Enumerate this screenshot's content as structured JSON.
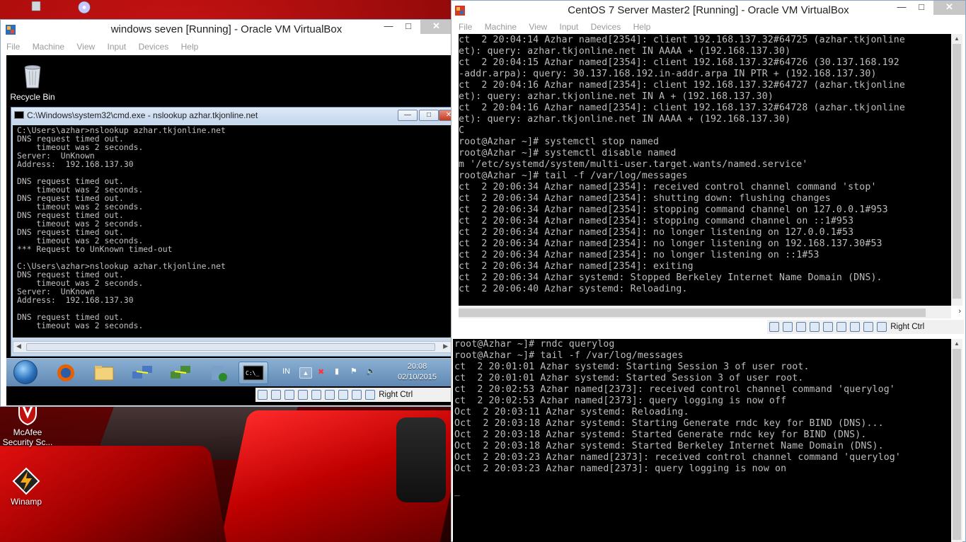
{
  "desktop": {
    "icons": [
      {
        "label": "Recycle Bin"
      },
      {
        "label": "McAfee Security Sc..."
      },
      {
        "label": "Winamp"
      }
    ]
  },
  "win7_vm": {
    "title": "windows seven [Running] - Oracle VM VirtualBox",
    "menu": [
      "File",
      "Machine",
      "View",
      "Input",
      "Devices",
      "Help"
    ],
    "guest_desktop_icon": "Recycle Bin",
    "cmd": {
      "title": "C:\\Windows\\system32\\cmd.exe - nslookup  azhar.tkjonline.net",
      "lines": [
        "C:\\Users\\azhar>nslookup azhar.tkjonline.net",
        "DNS request timed out.",
        "    timeout was 2 seconds.",
        "Server:  UnKnown",
        "Address:  192.168.137.30",
        "",
        "DNS request timed out.",
        "    timeout was 2 seconds.",
        "DNS request timed out.",
        "    timeout was 2 seconds.",
        "DNS request timed out.",
        "    timeout was 2 seconds.",
        "DNS request timed out.",
        "    timeout was 2 seconds.",
        "*** Request to UnKnown timed-out",
        "",
        "C:\\Users\\azhar>nslookup azhar.tkjonline.net",
        "DNS request timed out.",
        "    timeout was 2 seconds.",
        "Server:  UnKnown",
        "Address:  192.168.137.30",
        "",
        "DNS request timed out.",
        "    timeout was 2 seconds."
      ]
    },
    "taskbar": {
      "lang": "IN",
      "time": "20:08",
      "date": "02/10/2015"
    },
    "status_hostkey": "Right Ctrl"
  },
  "centos_vm": {
    "title": "CentOS 7 Server Master2 [Running] - Oracle VM VirtualBox",
    "menu": [
      "File",
      "Machine",
      "View",
      "Input",
      "Devices",
      "Help"
    ],
    "terminal_top": [
      "ct  2 20:04:14 Azhar named[2354]: client 192.168.137.32#64725 (azhar.tkjonline",
      "et): query: azhar.tkjonline.net IN AAAA + (192.168.137.30)",
      "ct  2 20:04:15 Azhar named[2354]: client 192.168.137.32#64726 (30.137.168.192",
      "-addr.arpa): query: 30.137.168.192.in-addr.arpa IN PTR + (192.168.137.30)",
      "ct  2 20:04:16 Azhar named[2354]: client 192.168.137.32#64727 (azhar.tkjonline",
      "et): query: azhar.tkjonline.net IN A + (192.168.137.30)",
      "ct  2 20:04:16 Azhar named[2354]: client 192.168.137.32#64728 (azhar.tkjonline",
      "et): query: azhar.tkjonline.net IN AAAA + (192.168.137.30)",
      "C",
      "root@Azhar ~]# systemctl stop named",
      "root@Azhar ~]# systemctl disable named",
      "m '/etc/systemd/system/multi-user.target.wants/named.service'",
      "root@Azhar ~]# tail -f /var/log/messages",
      "ct  2 20:06:34 Azhar named[2354]: received control channel command 'stop'",
      "ct  2 20:06:34 Azhar named[2354]: shutting down: flushing changes",
      "ct  2 20:06:34 Azhar named[2354]: stopping command channel on 127.0.0.1#953",
      "ct  2 20:06:34 Azhar named[2354]: stopping command channel on ::1#953",
      "ct  2 20:06:34 Azhar named[2354]: no longer listening on 127.0.0.1#53",
      "ct  2 20:06:34 Azhar named[2354]: no longer listening on 192.168.137.30#53",
      "ct  2 20:06:34 Azhar named[2354]: no longer listening on ::1#53",
      "ct  2 20:06:34 Azhar named[2354]: exiting",
      "ct  2 20:06:34 Azhar systemd: Stopped Berkeley Internet Name Domain (DNS).",
      "ct  2 20:06:40 Azhar systemd: Reloading."
    ],
    "status_hostkey": "Right Ctrl",
    "terminal_bottom": [
      "root@Azhar ~]# rndc querylog",
      "root@Azhar ~]# tail -f /var/log/messages",
      "ct  2 20:01:01 Azhar systemd: Starting Session 3 of user root.",
      "ct  2 20:01:01 Azhar systemd: Started Session 3 of user root.",
      "ct  2 20:02:53 Azhar named[2373]: received control channel command 'querylog'",
      "ct  2 20:02:53 Azhar named[2373]: query logging is now off",
      "Oct  2 20:03:11 Azhar systemd: Reloading.",
      "Oct  2 20:03:18 Azhar systemd: Starting Generate rndc key for BIND (DNS)...",
      "Oct  2 20:03:18 Azhar systemd: Started Generate rndc key for BIND (DNS).",
      "Oct  2 20:03:18 Azhar systemd: Started Berkeley Internet Name Domain (DNS).",
      "Oct  2 20:03:23 Azhar named[2373]: received control channel command 'querylog'",
      "Oct  2 20:03:23 Azhar named[2373]: query logging is now on",
      "",
      "_"
    ]
  }
}
